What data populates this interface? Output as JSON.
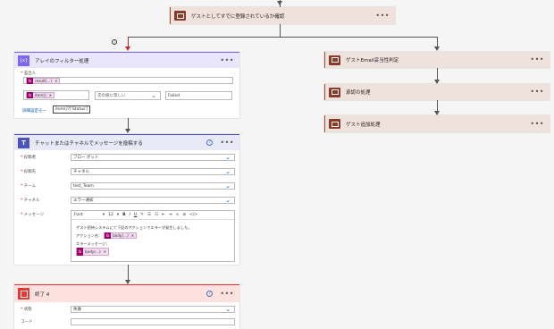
{
  "top_action": {
    "title": "ゲストとしてすでに登録されているか確認"
  },
  "filter_card": {
    "title": "アレイのフィルター処理",
    "from_label": "差出人",
    "from_chip": "result(...)",
    "item_chip": "item()",
    "operator": "次の値に等しい",
    "value": "Failed",
    "advanced": "詳細設定モー",
    "tooltip": "item()?['Status']"
  },
  "post_card": {
    "title": "チャットまたはチャネルでメッセージを投稿する",
    "poster_label": "投稿者",
    "poster_value": "フロー ボット",
    "post_in_label": "投稿先",
    "post_in_value": "チャネル",
    "team_label": "チーム",
    "team_value": "test_Team",
    "channel_label": "チャネル",
    "channel_value": "エラー通知",
    "message_label": "メッセージ",
    "editor": {
      "font": "Font",
      "size": "12"
    },
    "msg_line1": "ゲスト招待システムにて下記のアクションでエラーが発生しました。",
    "msg_line2": "アクション名：",
    "msg_chip1": "body(...)",
    "msg_line3": "エラーメッセージ：",
    "msg_chip2": "body(...)"
  },
  "end_card": {
    "title": "終了 4",
    "status_label": "状態",
    "status_value": "失敗",
    "code_label": "コード"
  },
  "right_actions": [
    {
      "title": "ゲストEmail妥当性判定"
    },
    {
      "title": "承認の処理"
    },
    {
      "title": "ゲスト追加処理"
    }
  ],
  "info_badge": "!",
  "colors": {
    "accent": "#8b3a2a",
    "filter": "#7b68ee",
    "teams": "#4b53bc",
    "end": "#e53935"
  }
}
